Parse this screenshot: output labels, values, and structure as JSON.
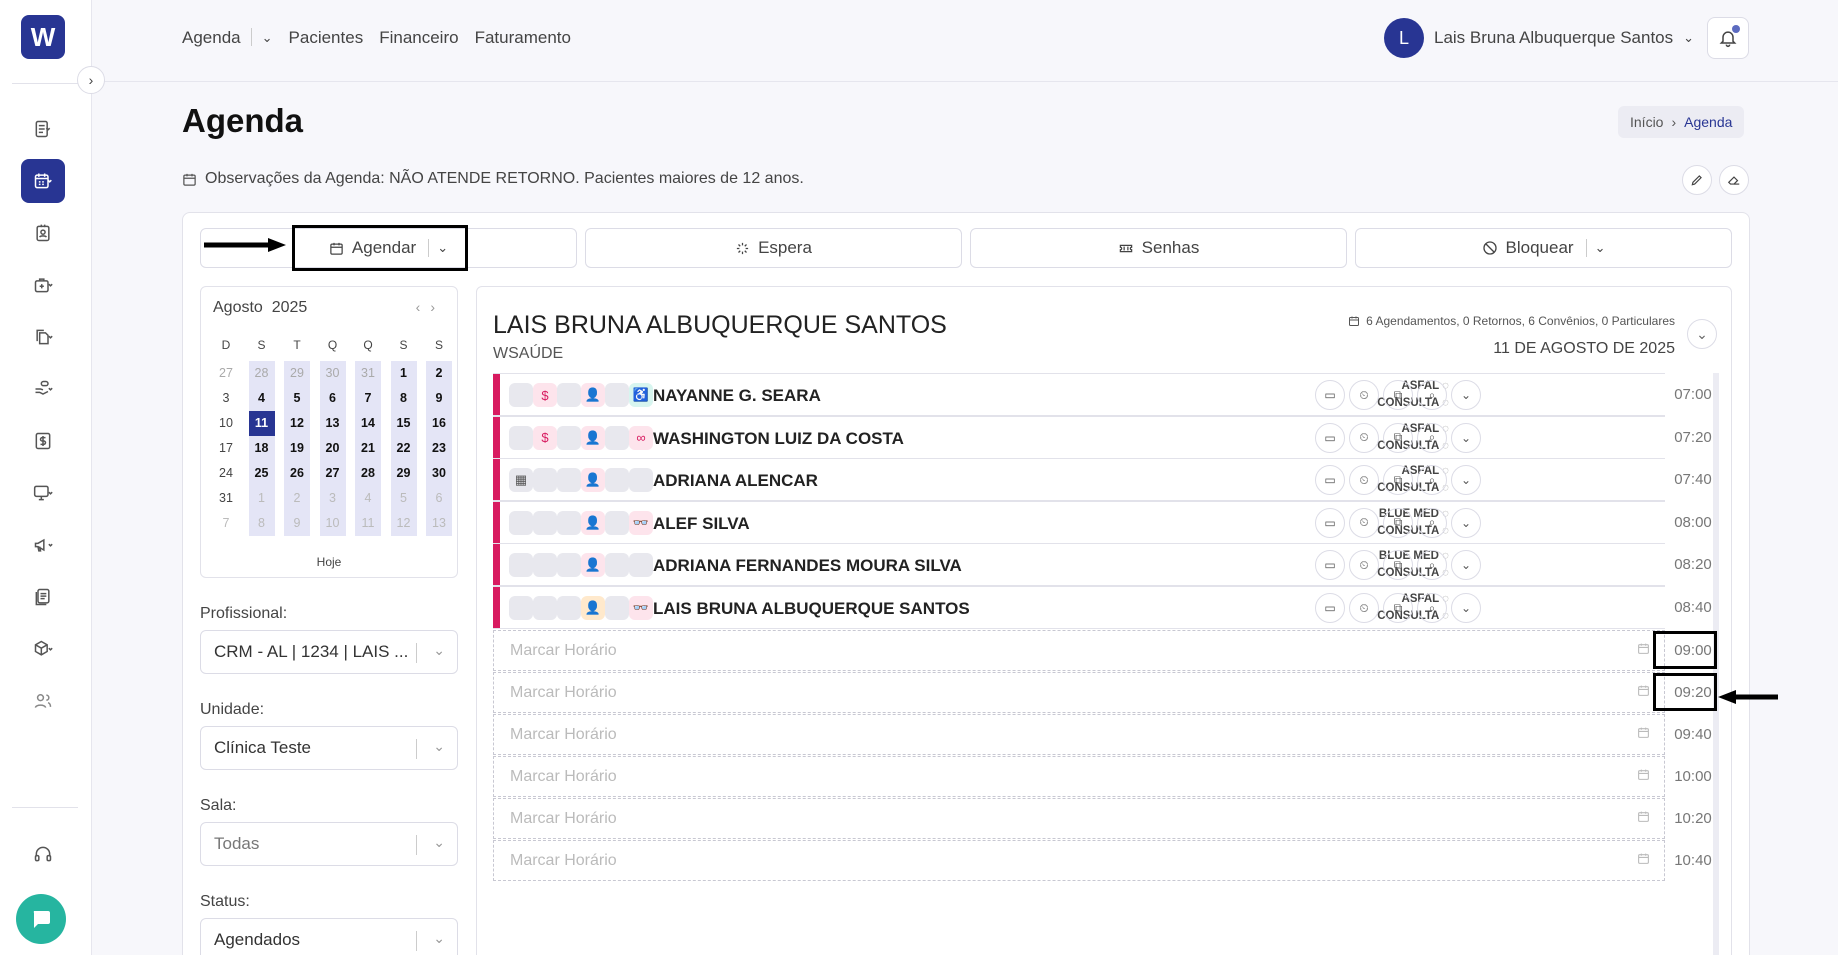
{
  "app": {
    "logo_text": "W"
  },
  "topnav": {
    "agenda": "Agenda",
    "pacientes": "Pacientes",
    "financeiro": "Financeiro",
    "faturamento": "Faturamento"
  },
  "user": {
    "initial": "L",
    "name": "Lais Bruna Albuquerque Santos"
  },
  "page": {
    "title": "Agenda",
    "breadcrumb_home": "Início",
    "breadcrumb_current": "Agenda"
  },
  "observacoes": "Observações da Agenda: NÃO ATENDE RETORNO. Pacientes maiores de 12 anos.",
  "actions": {
    "agendar": "Agendar",
    "espera": "Espera",
    "senhas": "Senhas",
    "bloquear": "Bloquear"
  },
  "calendar": {
    "month": "Agosto",
    "year": "2025",
    "weekdays": [
      "D",
      "S",
      "T",
      "Q",
      "Q",
      "S",
      "S"
    ],
    "weeks": [
      [
        "27",
        "28",
        "29",
        "30",
        "31",
        "1",
        "2"
      ],
      [
        "3",
        "4",
        "5",
        "6",
        "7",
        "8",
        "9"
      ],
      [
        "10",
        "11",
        "12",
        "13",
        "14",
        "15",
        "16"
      ],
      [
        "17",
        "18",
        "19",
        "20",
        "21",
        "22",
        "23"
      ],
      [
        "24",
        "25",
        "26",
        "27",
        "28",
        "29",
        "30"
      ],
      [
        "31",
        "1",
        "2",
        "3",
        "4",
        "5",
        "6"
      ],
      [
        "7",
        "8",
        "9",
        "10",
        "11",
        "12",
        "13"
      ]
    ],
    "today_label": "Hoje"
  },
  "filters": {
    "profissional_label": "Profissional:",
    "profissional_value": "CRM - AL | 1234 | LAIS ...",
    "unidade_label": "Unidade:",
    "unidade_value": "Clínica Teste",
    "sala_label": "Sala:",
    "sala_value": "Todas",
    "status_label": "Status:",
    "status_value": "Agendados"
  },
  "schedule": {
    "professional": "LAIS BRUNA ALBUQUERQUE SANTOS",
    "company": "WSAÚDE",
    "summary": "6 Agendamentos, 0 Retornos, 6 Convênios, 0 Particulares",
    "date": "11 DE AGOSTO DE 2025",
    "appointments": [
      {
        "name": "NAYANNE G. SEARA",
        "convenio": "ASFAL",
        "tipo": "CONSULTA",
        "time": "07:00"
      },
      {
        "name": "WASHINGTON LUIZ DA COSTA",
        "convenio": "ASFAL",
        "tipo": "CONSULTA",
        "time": "07:20"
      },
      {
        "name": "ADRIANA ALENCAR",
        "convenio": "ASFAL",
        "tipo": "CONSULTA",
        "time": "07:40"
      },
      {
        "name": "ALEF SILVA",
        "convenio": "BLUE MED",
        "tipo": "CONSULTA",
        "time": "08:00"
      },
      {
        "name": "ADRIANA FERNANDES MOURA SILVA",
        "convenio": "BLUE MED",
        "tipo": "CONSULTA",
        "time": "08:20"
      },
      {
        "name": "LAIS BRUNA ALBUQUERQUE SANTOS",
        "convenio": "ASFAL",
        "tipo": "CONSULTA",
        "time": "08:40"
      }
    ],
    "empty_label": "Marcar Horário",
    "empty_slots": [
      "09:00",
      "09:20",
      "09:40",
      "10:00",
      "10:20",
      "10:40"
    ]
  },
  "colors": {
    "primary": "#283593",
    "accent_bar": "#d81b60",
    "chat": "#26b5a0"
  }
}
